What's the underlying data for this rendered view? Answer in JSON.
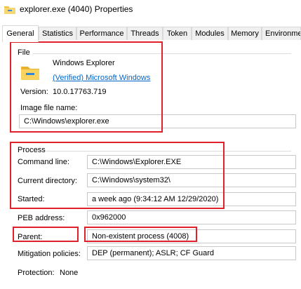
{
  "window": {
    "title": "explorer.exe (4040) Properties"
  },
  "tabs": [
    {
      "label": "General"
    },
    {
      "label": "Statistics"
    },
    {
      "label": "Performance"
    },
    {
      "label": "Threads"
    },
    {
      "label": "Token"
    },
    {
      "label": "Modules"
    },
    {
      "label": "Memory"
    },
    {
      "label": "Environment"
    }
  ],
  "file": {
    "group_title": "File",
    "name": "Windows Explorer",
    "verified": "(Verified) Microsoft Windows",
    "version_label": "Version:",
    "version_value": "10.0.17763.719",
    "image_label": "Image file name:",
    "image_value": "C:\\Windows\\explorer.exe"
  },
  "process": {
    "group_title": "Process",
    "command_label": "Command line:",
    "command_value": "C:\\Windows\\Explorer.EXE",
    "curdir_label": "Current directory:",
    "curdir_value": "C:\\Windows\\system32\\",
    "started_label": "Started:",
    "started_value": "a week ago (9:34:12 AM 12/29/2020)",
    "peb_label": "PEB address:",
    "peb_value": "0x962000",
    "parent_label": "Parent:",
    "parent_value": "Non-existent process (4008)",
    "mitigation_label": "Mitigation policies:",
    "mitigation_value": "DEP (permanent); ASLR; CF Guard",
    "protection_label": "Protection:",
    "protection_value": "None"
  },
  "colors": {
    "highlight_box": "#e0202a",
    "link": "#0066cc"
  }
}
